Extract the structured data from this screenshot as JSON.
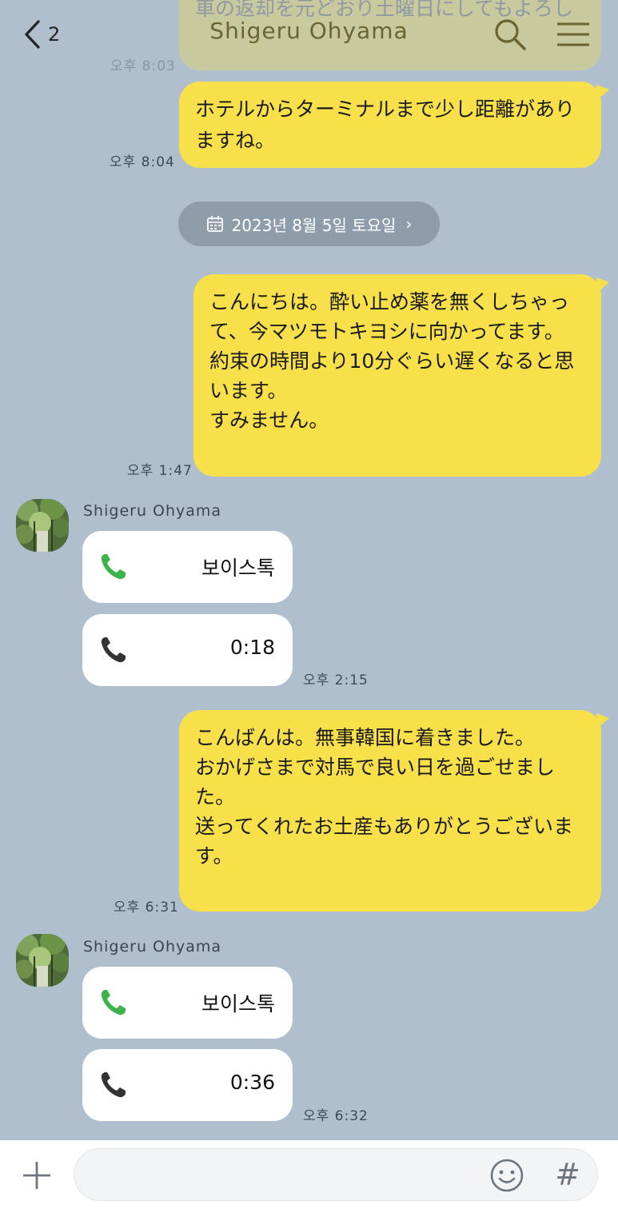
{
  "header": {
    "back_count": "2",
    "title": "Shigeru Ohyama"
  },
  "messages": {
    "top_partial": {
      "text": "車の返却を元どおり土曜日にしてもよろし",
      "time": "오후 8:03"
    },
    "m1": {
      "text": "ホテルからターミナルまで少し距離があり\nますね。",
      "time": "오후 8:04"
    },
    "date_divider": "2023년 8월 5일 토요일",
    "m2": {
      "text": "こんにちは。酔い止め薬を無くしちゃっ\nて、今マツモトキヨシに向かってます。\n約束の時間より10分ぐらい遅くなると思\nいます。\nすみません。",
      "time": "오후 1:47"
    },
    "group1": {
      "sender": "Shigeru Ohyama",
      "call1_label": "보이스톡",
      "call2_label": "0:18",
      "time": "오후 2:15"
    },
    "m3": {
      "text": "こんばんは。無事韓国に着きました。\nおかげさまで対馬で良い日を過ごせまし\nた。\n送ってくれたお土産もありがとうございま\nす。",
      "time": "오후 6:31"
    },
    "group2": {
      "sender": "Shigeru Ohyama",
      "call1_label": "보이스톡",
      "call2_label": "0:36",
      "time": "오후 6:32"
    }
  },
  "icons": {
    "back": "chevron-left-icon",
    "search": "search-icon",
    "menu": "hamburger-menu-icon",
    "calendar": "calendar-icon",
    "phone_active": "phone-green-icon",
    "phone_missed": "phone-dark-icon",
    "plus": "plus-icon",
    "emoji": "emoji-icon",
    "hash": "hash-icon"
  },
  "colors": {
    "background": "#b0bfcd",
    "my_bubble": "#f7e04a",
    "call_green": "#3cb34a",
    "date_pill": "#8f9dab"
  }
}
